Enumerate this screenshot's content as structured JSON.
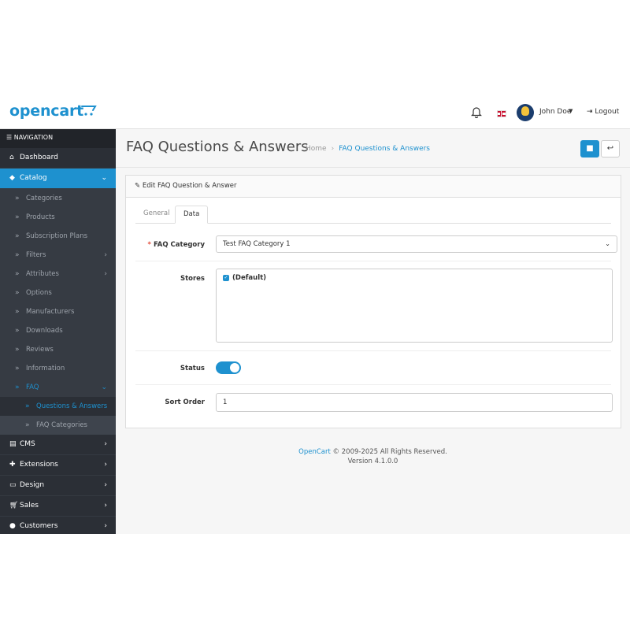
{
  "brand": {
    "logo_text": "opencart",
    "accent": "#1e91cf"
  },
  "header": {
    "user_name": "John Doe",
    "logout_label": "Logout"
  },
  "sidebar": {
    "heading": "NAVIGATION",
    "dashboard": "Dashboard",
    "catalog": "Catalog",
    "catalog_items": [
      "Categories",
      "Products",
      "Subscription Plans",
      "Filters",
      "Attributes",
      "Options",
      "Manufacturers",
      "Downloads",
      "Reviews",
      "Information"
    ],
    "faq": "FAQ",
    "faq_items": [
      "Questions & Answers",
      "FAQ Categories"
    ],
    "bottom": [
      "CMS",
      "Extensions",
      "Design",
      "Sales",
      "Customers"
    ]
  },
  "page": {
    "title": "FAQ Questions & Answers",
    "breadcrumb_home": "Home",
    "breadcrumb_current": "FAQ Questions & Answers"
  },
  "form": {
    "card_title": "Edit FAQ Question & Answer",
    "tab_general": "General",
    "tab_data": "Data",
    "category_label": "FAQ Category",
    "category_value": "Test FAQ Category 1",
    "stores_label": "Stores",
    "store_default": "(Default)",
    "status_label": "Status",
    "status_on": true,
    "sort_label": "Sort Order",
    "sort_value": "1"
  },
  "footer": {
    "link": "OpenCart",
    "copyright": " © 2009-2025 All Rights Reserved.",
    "version": "Version 4.1.0.0"
  }
}
